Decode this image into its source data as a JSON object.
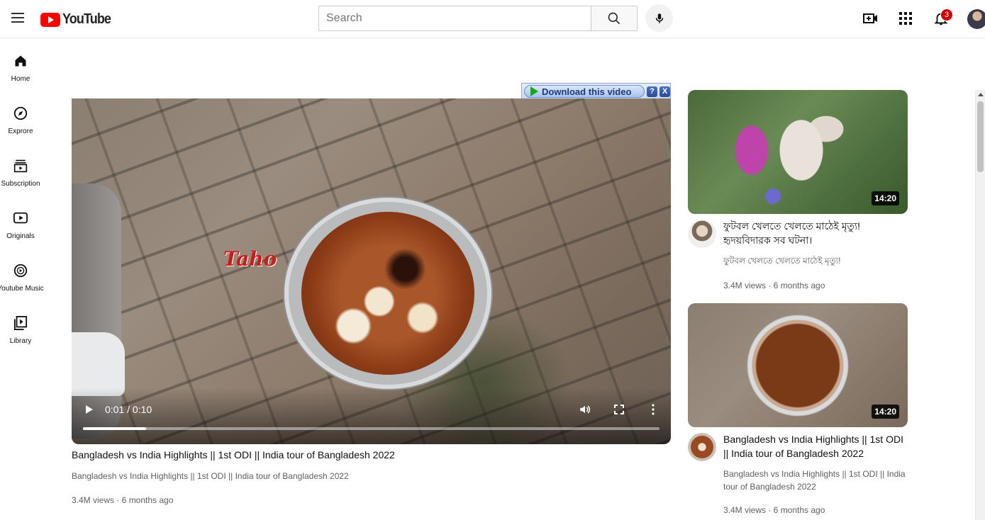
{
  "header": {
    "logo_text": "YouTube",
    "search_placeholder": "Search",
    "notification_count": "3"
  },
  "sidebar": {
    "items": [
      {
        "label": "Home",
        "icon": "home-icon"
      },
      {
        "label": "Exprore",
        "icon": "compass-icon"
      },
      {
        "label": "Subscription",
        "icon": "subscriptions-icon"
      },
      {
        "label": "Originals",
        "icon": "originals-icon"
      },
      {
        "label": "Youtube Music",
        "icon": "music-icon"
      },
      {
        "label": "Library",
        "icon": "library-icon"
      }
    ]
  },
  "player": {
    "watermark": "Taho",
    "time": "0:01 / 0:10",
    "progress_fraction": 0.11,
    "download_label": "Download this video",
    "help_label": "?",
    "close_label": "X"
  },
  "video": {
    "title": "Bangladesh vs India Highlights || 1st ODI || India tour of Bangladesh 2022",
    "description": "Bangladesh vs India Highlights || 1st ODI || India tour of Bangladesh 2022",
    "meta": "3.4M views · 6 months ago"
  },
  "recommendations": [
    {
      "duration": "14:20",
      "title": "ফুটবল খেলতে খেলতে মাঠেই মৃত্যু! হৃদয়বিদারক সব ঘটনা।",
      "description": "ফুটবল খেলতে খেলতে মাঠেই মৃত্যু!",
      "meta": "3.4M views · 6 months ago"
    },
    {
      "duration": "14:20",
      "title": "Bangladesh vs India Highlights || 1st ODI || India tour of Bangladesh 2022",
      "description": "Bangladesh vs India Highlights || 1st ODI || India tour of Bangladesh 2022",
      "meta": "3.4M views · 6 months ago"
    }
  ]
}
